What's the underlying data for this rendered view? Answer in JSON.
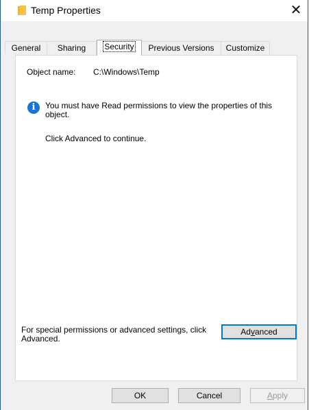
{
  "window": {
    "title": "Temp Properties"
  },
  "tabs": [
    {
      "label": "General"
    },
    {
      "label": "Sharing"
    },
    {
      "label": "Security",
      "active": true
    },
    {
      "label": "Previous Versions"
    },
    {
      "label": "Customize"
    }
  ],
  "security": {
    "object_name_label": "Object name:",
    "object_name_value": "C:\\Windows\\Temp",
    "info_message": "You must have Read permissions to view the properties of this object.",
    "advanced_hint": "Click Advanced to continue.",
    "special_permissions_text": "For special permissions or advanced settings, click Advanced.",
    "advanced_button": {
      "pre": "Ad",
      "accel": "v",
      "post": "anced"
    }
  },
  "footer": {
    "ok_label": "OK",
    "cancel_label": "Cancel",
    "apply_button": {
      "accel": "A",
      "post": "pply"
    }
  },
  "icons": {
    "window_icon": "folder-icon",
    "info": "info-icon",
    "close": "close-icon"
  },
  "colors": {
    "accent": "#0078d7",
    "info_icon": "#1a74d6",
    "folder": "#f5c242"
  }
}
